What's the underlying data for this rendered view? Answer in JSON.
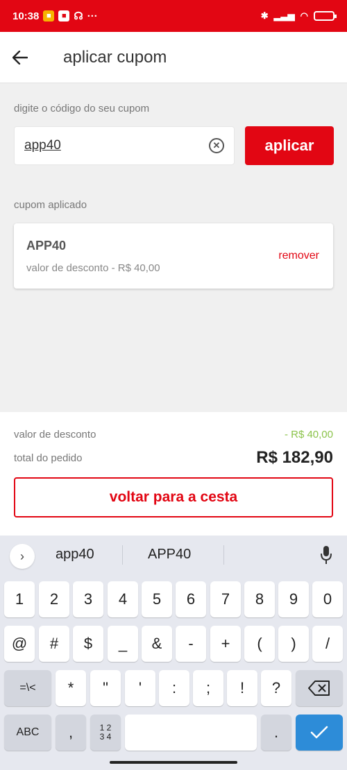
{
  "status_bar": {
    "time": "10:38",
    "dots": "···",
    "battery": "3"
  },
  "app_bar": {
    "title": "aplicar cupom"
  },
  "coupon_entry": {
    "label": "digite o código do seu cupom",
    "value": "app40",
    "apply_label": "aplicar"
  },
  "applied_coupon": {
    "section_label": "cupom aplicado",
    "code": "APP40",
    "description": "valor de desconto - R$ 40,00",
    "remove_label": "remover"
  },
  "summary": {
    "discount_label": "valor de desconto",
    "discount_value": "- R$ 40,00",
    "total_label": "total do pedido",
    "total_value": "R$ 182,90",
    "back_button": "voltar para a cesta"
  },
  "keyboard": {
    "suggestions": [
      "app40",
      "APP40"
    ],
    "rows": [
      [
        "1",
        "2",
        "3",
        "4",
        "5",
        "6",
        "7",
        "8",
        "9",
        "0"
      ],
      [
        "@",
        "#",
        "$",
        "_",
        "&",
        "-",
        "+",
        "(",
        ")",
        "/"
      ],
      [
        "=\\<",
        "*",
        "\"",
        "'",
        ":",
        ";",
        "!",
        "?"
      ]
    ],
    "abc_label": "ABC",
    "comma": ",",
    "num_label_top": "1 2",
    "num_label_bottom": "3 4",
    "period": "."
  },
  "colors": {
    "brand": "#e20613",
    "discount": "#8bc34a",
    "enter": "#2d8cd8"
  }
}
